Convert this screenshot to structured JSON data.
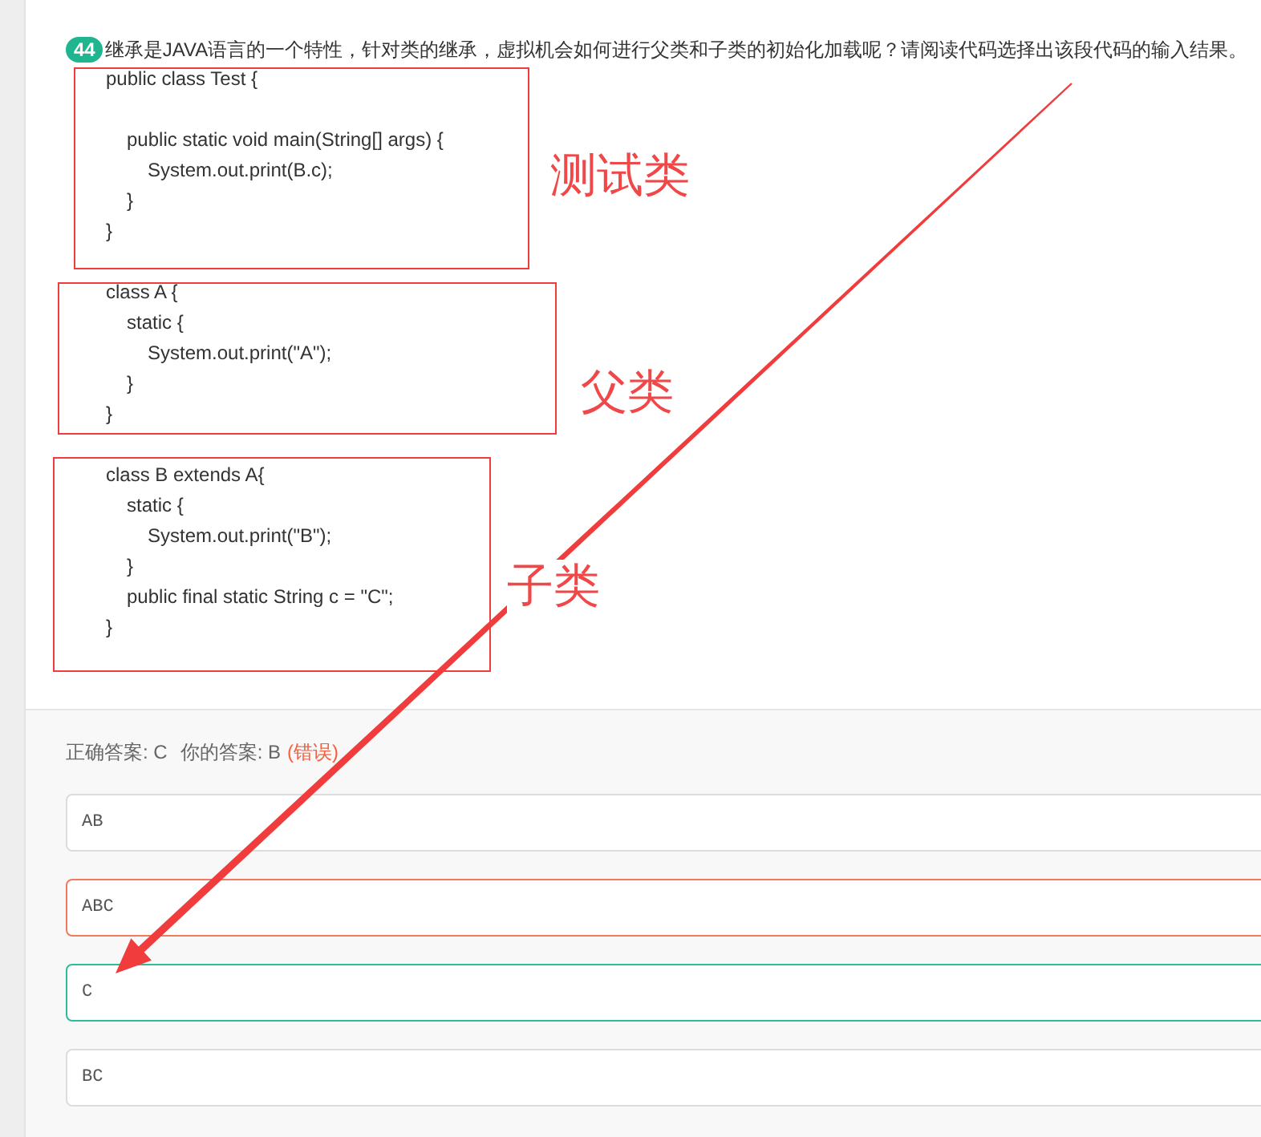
{
  "question": {
    "number": "44",
    "text": "继承是JAVA语言的一个特性，针对类的继承，虚拟机会如何进行父类和子类的初始化加载呢？请阅读代码选择出该段代码的输入结果。"
  },
  "code_blocks": [
    {
      "lines": [
        {
          "text": "public class Test {",
          "children": [
            {
              "kind": "blank"
            },
            {
              "kind": "code",
              "text": "public static void main(String[] args) {",
              "children": [
                {
                  "text": "System.out.print(B.c);"
                }
              ]
            },
            {
              "kind": "code",
              "text": "}"
            }
          ]
        },
        {
          "text": "}"
        }
      ]
    },
    {
      "lines": [
        {
          "text": "class A {",
          "children": [
            {
              "text": "static {",
              "children": [
                {
                  "text": "System.out.print(\"A\");"
                }
              ]
            },
            {
              "text": "}"
            }
          ]
        },
        {
          "text": "}"
        }
      ]
    },
    {
      "lines": [
        {
          "text": "class B extends A{",
          "children": [
            {
              "text": "static {",
              "children": [
                {
                  "text": "System.out.print(\"B\");"
                }
              ]
            },
            {
              "text": "}"
            },
            {
              "text": "public final static String c = \"C\";"
            }
          ]
        },
        {
          "text": "}"
        }
      ]
    }
  ],
  "annotations": [
    {
      "label": "测试类"
    },
    {
      "label": "父类"
    },
    {
      "label": "子类"
    }
  ],
  "result": {
    "correct": "正确答案: C",
    "yours": "你的答案: B",
    "verdict": "(错误)"
  },
  "options": [
    {
      "text": "AB",
      "kind": "plain"
    },
    {
      "text": "ABC",
      "kind": "wrong"
    },
    {
      "text": "C",
      "kind": "correct"
    },
    {
      "text": "BC",
      "kind": "plain"
    }
  ]
}
